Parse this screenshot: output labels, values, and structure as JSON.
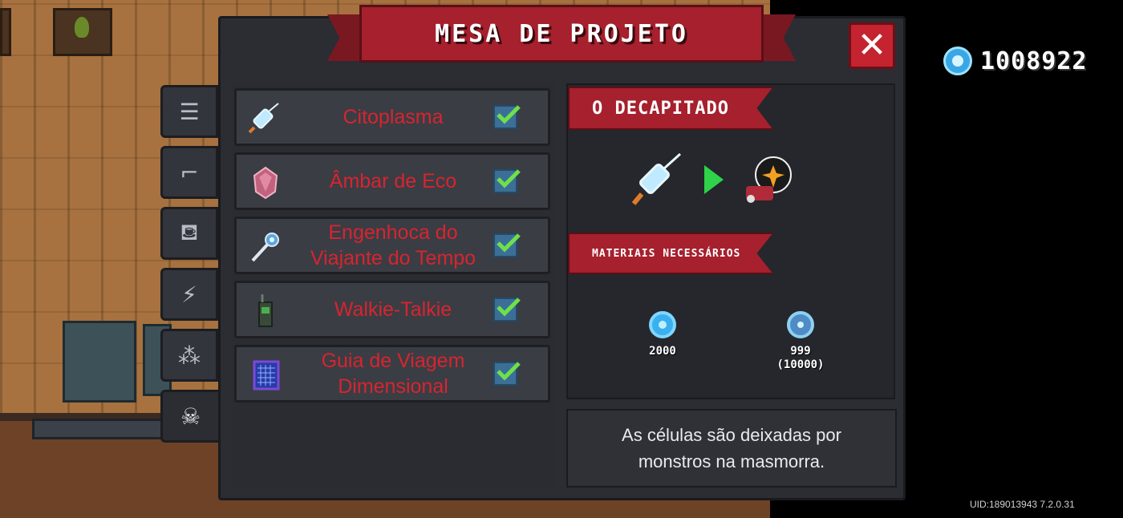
{
  "window": {
    "title": "MESA DE PROJETO",
    "close_label": "✕"
  },
  "currency": {
    "icon": "blue-gem-icon",
    "amount": "1008922"
  },
  "tabs": [
    {
      "icon": "list-icon",
      "glyph": "☰",
      "active": false
    },
    {
      "icon": "gun-icon",
      "glyph": "⌐",
      "active": false
    },
    {
      "icon": "shirt-icon",
      "glyph": "⛾",
      "active": false
    },
    {
      "icon": "lightning-icon",
      "glyph": "⚡",
      "active": false
    },
    {
      "icon": "puzzle-icon",
      "glyph": "⁂",
      "active": false
    },
    {
      "icon": "ghost-icon",
      "glyph": "☠",
      "active": true
    }
  ],
  "items": [
    {
      "label": "Citoplasma",
      "icon": "syringe-icon",
      "checked": true
    },
    {
      "label": "Âmbar de Eco",
      "icon": "amber-crystal-icon",
      "checked": true
    },
    {
      "label": "Engenhoca do Viajante do Tempo",
      "icon": "time-wand-icon",
      "checked": true
    },
    {
      "label": "Walkie-Talkie",
      "icon": "walkie-talkie-icon",
      "checked": true
    },
    {
      "label": "Guia de Viagem Dimensional",
      "icon": "dimensional-guide-icon",
      "checked": true
    }
  ],
  "detail": {
    "boss_name": "O DECAPITADO",
    "materials_title": "MATERIAIS NECESSÁRIOS",
    "materials": [
      {
        "icon": "gem-icon",
        "amount": "2000",
        "owned": ""
      },
      {
        "icon": "cell-icon",
        "amount": "999",
        "owned": "(10000)"
      }
    ],
    "description": "As células são deixadas por monstros na masmorra."
  },
  "footer": {
    "uid": "UID:189013943 7.2.0.31"
  },
  "colors": {
    "accent_red": "#a6202d",
    "label_red": "#d8242f",
    "check_green": "#6fe04a",
    "gem_blue": "#3ab0ee"
  }
}
